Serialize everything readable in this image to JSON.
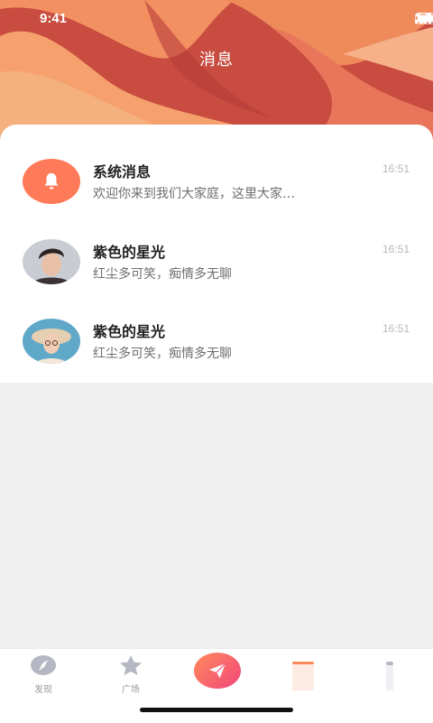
{
  "status_bar": {
    "time": "9:41"
  },
  "header": {
    "title": "消息"
  },
  "messages": [
    {
      "title": "系统消息",
      "time": "16:51",
      "preview": "欢迎你来到我们大家庭，这里大家…",
      "avatar": "bell-icon"
    },
    {
      "title": "紫色的星光",
      "time": "16:51",
      "preview": "红尘多可笑，痴情多无聊",
      "avatar": "user-avatar-boy"
    },
    {
      "title": "紫色的星光",
      "time": "16:51",
      "preview": "红尘多可笑，痴情多无聊",
      "avatar": "user-avatar-girl-hat"
    }
  ],
  "tabbar": {
    "tabs": [
      {
        "label": "发现",
        "icon": "compass-icon"
      },
      {
        "label": "广场",
        "icon": "star-icon"
      },
      {
        "label": "",
        "icon": "paper-plane-icon"
      },
      {
        "label": "",
        "icon": "message-icon"
      },
      {
        "label": "",
        "icon": "profile-icon"
      }
    ]
  },
  "colors": {
    "accent": "#ff7a58",
    "header_bg": "#c84c3f",
    "dune_light": "#f59462"
  }
}
